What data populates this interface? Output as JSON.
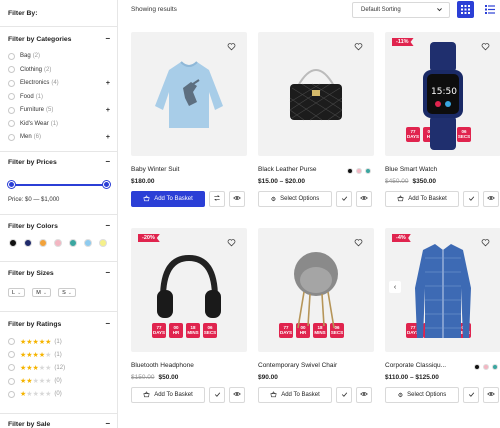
{
  "sidebar": {
    "title": "Filter By:",
    "categories": {
      "heading": "Filter by Categories",
      "items": [
        {
          "label": "Bag",
          "count": "(2)",
          "expandable": false
        },
        {
          "label": "Clothing",
          "count": "(2)",
          "expandable": false
        },
        {
          "label": "Electronics",
          "count": "(4)",
          "expandable": true
        },
        {
          "label": "Food",
          "count": "(1)",
          "expandable": false
        },
        {
          "label": "Furniture",
          "count": "(5)",
          "expandable": true
        },
        {
          "label": "Kid's Wear",
          "count": "(1)",
          "expandable": false
        },
        {
          "label": "Men",
          "count": "(6)",
          "expandable": true
        }
      ]
    },
    "prices": {
      "heading": "Filter by Prices",
      "text": "Price: $0 — $1,000"
    },
    "colors": {
      "heading": "Filter by Colors",
      "swatches": [
        "#111111",
        "#1f2a6b",
        "#f2a23a",
        "#f3b6c2",
        "#3aa6a0",
        "#8ecbef",
        "#f5f08a"
      ]
    },
    "sizes": {
      "heading": "Filter by Sizes",
      "items": [
        "L",
        "M",
        "S"
      ]
    },
    "ratings": {
      "heading": "Filter by Ratings",
      "items": [
        {
          "stars": 5,
          "count": "(1)"
        },
        {
          "stars": 4,
          "count": "(1)"
        },
        {
          "stars": 3,
          "count": "(12)"
        },
        {
          "stars": 2,
          "count": "(0)"
        },
        {
          "stars": 1,
          "count": "(0)"
        }
      ]
    },
    "sale": {
      "heading": "Filter by Sale"
    }
  },
  "toolbar": {
    "showing": "Showing results",
    "sort_value": "Default Sorting"
  },
  "timer_labels": {
    "days": "DAYS",
    "hr": "HR",
    "mins": "MINS",
    "secs": "SECS"
  },
  "products": [
    {
      "name": "Baby Winter Suit",
      "price": "$180.00",
      "old_price": "",
      "button": "Add To Basket",
      "discount": "",
      "timer": null,
      "colors": []
    },
    {
      "name": "Black Leather Purse",
      "price": "$15.00 – $20.00",
      "old_price": "",
      "button": "Select Options",
      "discount": "",
      "timer": null,
      "colors": [
        "#111111",
        "#f3b6c2",
        "#3aa6a0"
      ]
    },
    {
      "name": "Blue Smart Watch",
      "price": "$350.00",
      "old_price": "$450.00",
      "button": "Add To Basket",
      "discount": "-11%",
      "timer": {
        "days": "77",
        "hr": "00",
        "mins": "18",
        "secs": "06"
      },
      "colors": []
    },
    {
      "name": "Bluetooth Headphone",
      "price": "$50.00",
      "old_price": "$150.00",
      "button": "Add To Basket",
      "discount": "-20%",
      "timer": {
        "days": "77",
        "hr": "00",
        "mins": "18",
        "secs": "06"
      },
      "colors": []
    },
    {
      "name": "Contemporary Swivel Chair",
      "price": "$90.00",
      "old_price": "",
      "button": "Add To Basket",
      "discount": "",
      "timer": {
        "days": "77",
        "hr": "00",
        "mins": "18",
        "secs": "06"
      },
      "colors": []
    },
    {
      "name": "Corporate Classiqu...",
      "price": "$110.00 – $125.00",
      "old_price": "",
      "button": "Select Options",
      "discount": "-4%",
      "timer": {
        "days": "77",
        "hr": "00",
        "mins": "18",
        "secs": "06"
      },
      "colors": [
        "#111111",
        "#f3b6c2",
        "#3aa6a0"
      ]
    }
  ]
}
